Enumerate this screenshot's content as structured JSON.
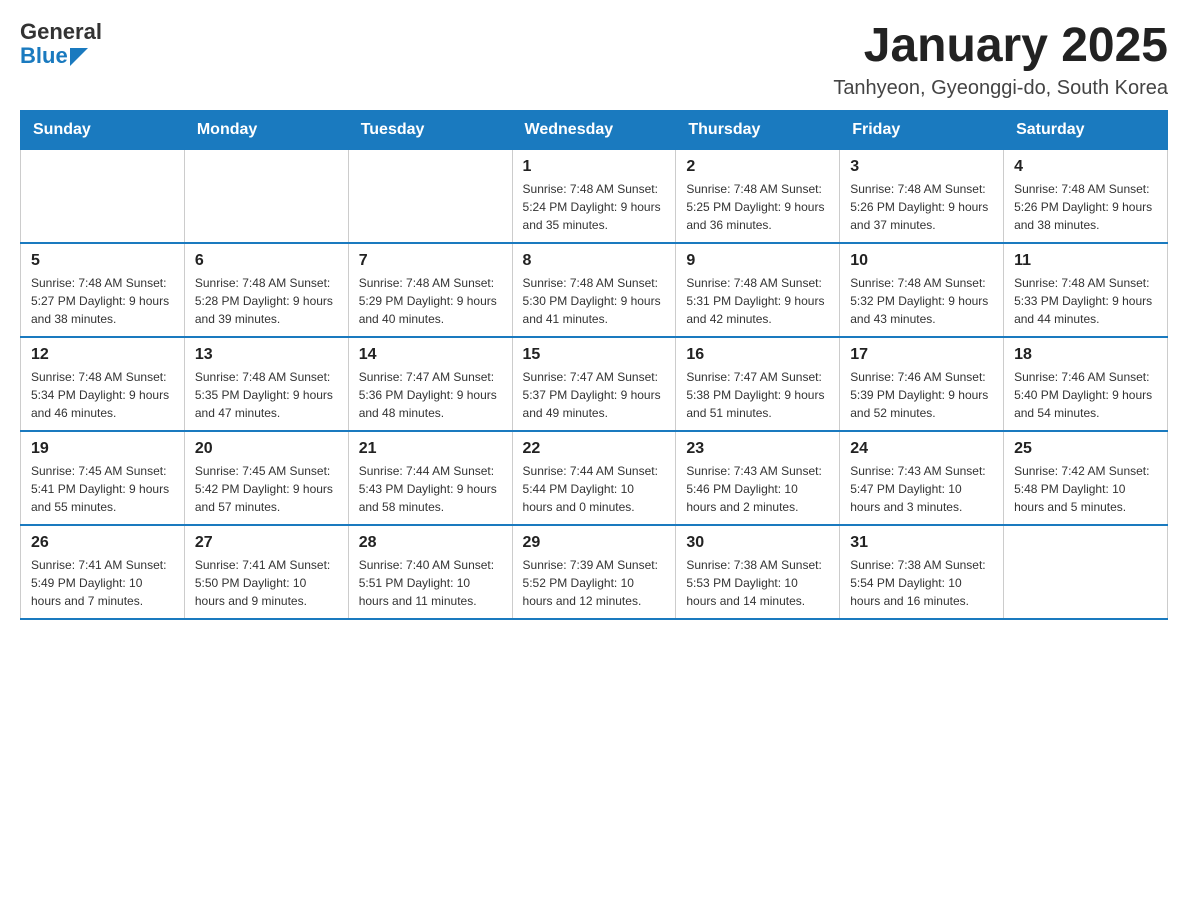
{
  "header": {
    "logo_general": "General",
    "logo_blue": "Blue",
    "month_title": "January 2025",
    "location": "Tanhyeon, Gyeonggi-do, South Korea"
  },
  "days_of_week": [
    "Sunday",
    "Monday",
    "Tuesday",
    "Wednesday",
    "Thursday",
    "Friday",
    "Saturday"
  ],
  "weeks": [
    [
      {
        "day": "",
        "info": ""
      },
      {
        "day": "",
        "info": ""
      },
      {
        "day": "",
        "info": ""
      },
      {
        "day": "1",
        "info": "Sunrise: 7:48 AM\nSunset: 5:24 PM\nDaylight: 9 hours and 35 minutes."
      },
      {
        "day": "2",
        "info": "Sunrise: 7:48 AM\nSunset: 5:25 PM\nDaylight: 9 hours and 36 minutes."
      },
      {
        "day": "3",
        "info": "Sunrise: 7:48 AM\nSunset: 5:26 PM\nDaylight: 9 hours and 37 minutes."
      },
      {
        "day": "4",
        "info": "Sunrise: 7:48 AM\nSunset: 5:26 PM\nDaylight: 9 hours and 38 minutes."
      }
    ],
    [
      {
        "day": "5",
        "info": "Sunrise: 7:48 AM\nSunset: 5:27 PM\nDaylight: 9 hours and 38 minutes."
      },
      {
        "day": "6",
        "info": "Sunrise: 7:48 AM\nSunset: 5:28 PM\nDaylight: 9 hours and 39 minutes."
      },
      {
        "day": "7",
        "info": "Sunrise: 7:48 AM\nSunset: 5:29 PM\nDaylight: 9 hours and 40 minutes."
      },
      {
        "day": "8",
        "info": "Sunrise: 7:48 AM\nSunset: 5:30 PM\nDaylight: 9 hours and 41 minutes."
      },
      {
        "day": "9",
        "info": "Sunrise: 7:48 AM\nSunset: 5:31 PM\nDaylight: 9 hours and 42 minutes."
      },
      {
        "day": "10",
        "info": "Sunrise: 7:48 AM\nSunset: 5:32 PM\nDaylight: 9 hours and 43 minutes."
      },
      {
        "day": "11",
        "info": "Sunrise: 7:48 AM\nSunset: 5:33 PM\nDaylight: 9 hours and 44 minutes."
      }
    ],
    [
      {
        "day": "12",
        "info": "Sunrise: 7:48 AM\nSunset: 5:34 PM\nDaylight: 9 hours and 46 minutes."
      },
      {
        "day": "13",
        "info": "Sunrise: 7:48 AM\nSunset: 5:35 PM\nDaylight: 9 hours and 47 minutes."
      },
      {
        "day": "14",
        "info": "Sunrise: 7:47 AM\nSunset: 5:36 PM\nDaylight: 9 hours and 48 minutes."
      },
      {
        "day": "15",
        "info": "Sunrise: 7:47 AM\nSunset: 5:37 PM\nDaylight: 9 hours and 49 minutes."
      },
      {
        "day": "16",
        "info": "Sunrise: 7:47 AM\nSunset: 5:38 PM\nDaylight: 9 hours and 51 minutes."
      },
      {
        "day": "17",
        "info": "Sunrise: 7:46 AM\nSunset: 5:39 PM\nDaylight: 9 hours and 52 minutes."
      },
      {
        "day": "18",
        "info": "Sunrise: 7:46 AM\nSunset: 5:40 PM\nDaylight: 9 hours and 54 minutes."
      }
    ],
    [
      {
        "day": "19",
        "info": "Sunrise: 7:45 AM\nSunset: 5:41 PM\nDaylight: 9 hours and 55 minutes."
      },
      {
        "day": "20",
        "info": "Sunrise: 7:45 AM\nSunset: 5:42 PM\nDaylight: 9 hours and 57 minutes."
      },
      {
        "day": "21",
        "info": "Sunrise: 7:44 AM\nSunset: 5:43 PM\nDaylight: 9 hours and 58 minutes."
      },
      {
        "day": "22",
        "info": "Sunrise: 7:44 AM\nSunset: 5:44 PM\nDaylight: 10 hours and 0 minutes."
      },
      {
        "day": "23",
        "info": "Sunrise: 7:43 AM\nSunset: 5:46 PM\nDaylight: 10 hours and 2 minutes."
      },
      {
        "day": "24",
        "info": "Sunrise: 7:43 AM\nSunset: 5:47 PM\nDaylight: 10 hours and 3 minutes."
      },
      {
        "day": "25",
        "info": "Sunrise: 7:42 AM\nSunset: 5:48 PM\nDaylight: 10 hours and 5 minutes."
      }
    ],
    [
      {
        "day": "26",
        "info": "Sunrise: 7:41 AM\nSunset: 5:49 PM\nDaylight: 10 hours and 7 minutes."
      },
      {
        "day": "27",
        "info": "Sunrise: 7:41 AM\nSunset: 5:50 PM\nDaylight: 10 hours and 9 minutes."
      },
      {
        "day": "28",
        "info": "Sunrise: 7:40 AM\nSunset: 5:51 PM\nDaylight: 10 hours and 11 minutes."
      },
      {
        "day": "29",
        "info": "Sunrise: 7:39 AM\nSunset: 5:52 PM\nDaylight: 10 hours and 12 minutes."
      },
      {
        "day": "30",
        "info": "Sunrise: 7:38 AM\nSunset: 5:53 PM\nDaylight: 10 hours and 14 minutes."
      },
      {
        "day": "31",
        "info": "Sunrise: 7:38 AM\nSunset: 5:54 PM\nDaylight: 10 hours and 16 minutes."
      },
      {
        "day": "",
        "info": ""
      }
    ]
  ]
}
